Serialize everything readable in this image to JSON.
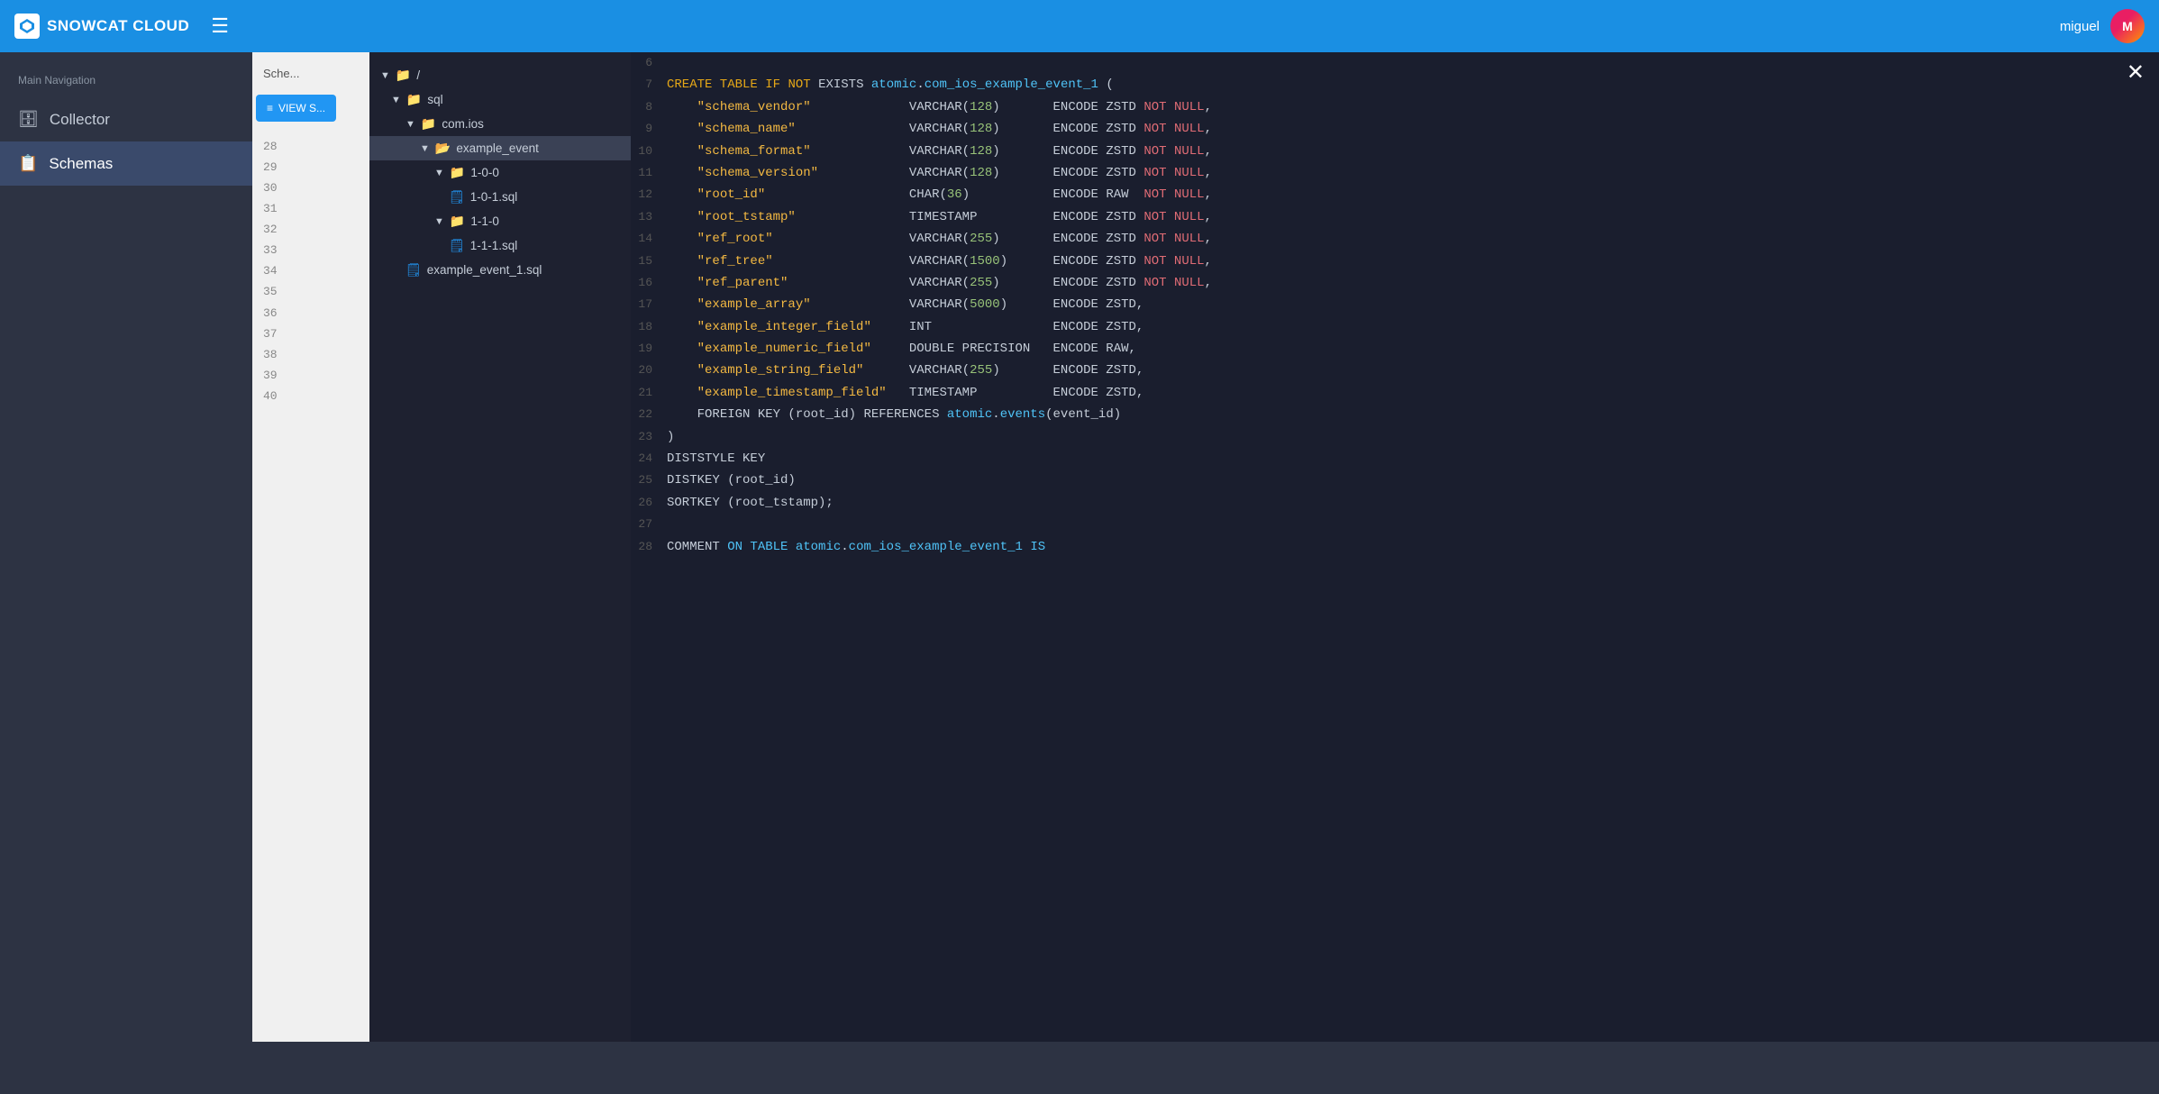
{
  "header": {
    "logo_text": "SNOWCAT CLOUD",
    "hamburger_label": "☰",
    "user_name": "miguel"
  },
  "sidebar": {
    "nav_label": "Main Navigation",
    "items": [
      {
        "id": "collector",
        "label": "Collector",
        "icon": "🗄",
        "active": false
      },
      {
        "id": "schemas",
        "label": "Schemas",
        "icon": "📋",
        "active": true
      }
    ]
  },
  "middle_panel": {
    "schema_label": "Sche...",
    "view_sql_label": "VIEW S...",
    "line_numbers": [
      "28",
      "29",
      "30",
      "31",
      "32",
      "33",
      "34",
      "35",
      "36",
      "37",
      "38",
      "39",
      "40"
    ]
  },
  "file_tree": {
    "items": [
      {
        "indent": 0,
        "type": "folder",
        "arrow": "▼",
        "name": "/",
        "selected": false
      },
      {
        "indent": 1,
        "type": "folder",
        "arrow": "▼",
        "name": "sql",
        "selected": false
      },
      {
        "indent": 2,
        "type": "folder",
        "arrow": "▼",
        "name": "com.ios",
        "selected": false
      },
      {
        "indent": 3,
        "type": "folder-selected",
        "arrow": "▼",
        "name": "example_event",
        "selected": true
      },
      {
        "indent": 4,
        "type": "folder",
        "arrow": "▼",
        "name": "1-0-0",
        "selected": false
      },
      {
        "indent": 5,
        "type": "file-sql",
        "name": "1-0-1.sql",
        "selected": false
      },
      {
        "indent": 4,
        "type": "folder",
        "arrow": "▼",
        "name": "1-1-0",
        "selected": false
      },
      {
        "indent": 5,
        "type": "file-sql",
        "name": "1-1-1.sql",
        "selected": false
      },
      {
        "indent": 2,
        "type": "file-js",
        "name": "example_event_1.sql",
        "selected": false
      }
    ]
  },
  "code": {
    "close_label": "✕",
    "lines": [
      {
        "num": "6",
        "content": ""
      },
      {
        "num": "7",
        "content": "CREATE TABLE IF NOT EXISTS atomic.com_ios_example_event_1 ("
      },
      {
        "num": "8",
        "content": "    \"schema_vendor\"             VARCHAR(128)       ENCODE ZSTD NOT NULL,"
      },
      {
        "num": "9",
        "content": "    \"schema_name\"               VARCHAR(128)       ENCODE ZSTD NOT NULL,"
      },
      {
        "num": "10",
        "content": "    \"schema_format\"             VARCHAR(128)       ENCODE ZSTD NOT NULL,"
      },
      {
        "num": "11",
        "content": "    \"schema_version\"            VARCHAR(128)       ENCODE ZSTD NOT NULL,"
      },
      {
        "num": "12",
        "content": "    \"root_id\"                   CHAR(36)           ENCODE RAW  NOT NULL,"
      },
      {
        "num": "13",
        "content": "    \"root_tstamp\"               TIMESTAMP          ENCODE ZSTD NOT NULL,"
      },
      {
        "num": "14",
        "content": "    \"ref_root\"                  VARCHAR(255)       ENCODE ZSTD NOT NULL,"
      },
      {
        "num": "15",
        "content": "    \"ref_tree\"                  VARCHAR(1500)      ENCODE ZSTD NOT NULL,"
      },
      {
        "num": "16",
        "content": "    \"ref_parent\"                VARCHAR(255)       ENCODE ZSTD NOT NULL,"
      },
      {
        "num": "17",
        "content": "    \"example_array\"             VARCHAR(5000)      ENCODE ZSTD,"
      },
      {
        "num": "18",
        "content": "    \"example_integer_field\"     INT                ENCODE ZSTD,"
      },
      {
        "num": "19",
        "content": "    \"example_numeric_field\"     DOUBLE PRECISION   ENCODE RAW,"
      },
      {
        "num": "20",
        "content": "    \"example_string_field\"      VARCHAR(255)       ENCODE ZSTD,"
      },
      {
        "num": "21",
        "content": "    \"example_timestamp_field\"   TIMESTAMP          ENCODE ZSTD,"
      },
      {
        "num": "22",
        "content": "    FOREIGN KEY (root_id) REFERENCES atomic.events(event_id)"
      },
      {
        "num": "23",
        "content": ")"
      },
      {
        "num": "24",
        "content": "DISTSTYLE KEY"
      },
      {
        "num": "25",
        "content": "DISTKEY (root_id)"
      },
      {
        "num": "26",
        "content": "SORTKEY (root_tstamp);"
      },
      {
        "num": "27",
        "content": ""
      },
      {
        "num": "28",
        "content": "COMMENT ON TABLE atomic.com_ios_example_event_1 IS"
      }
    ]
  }
}
